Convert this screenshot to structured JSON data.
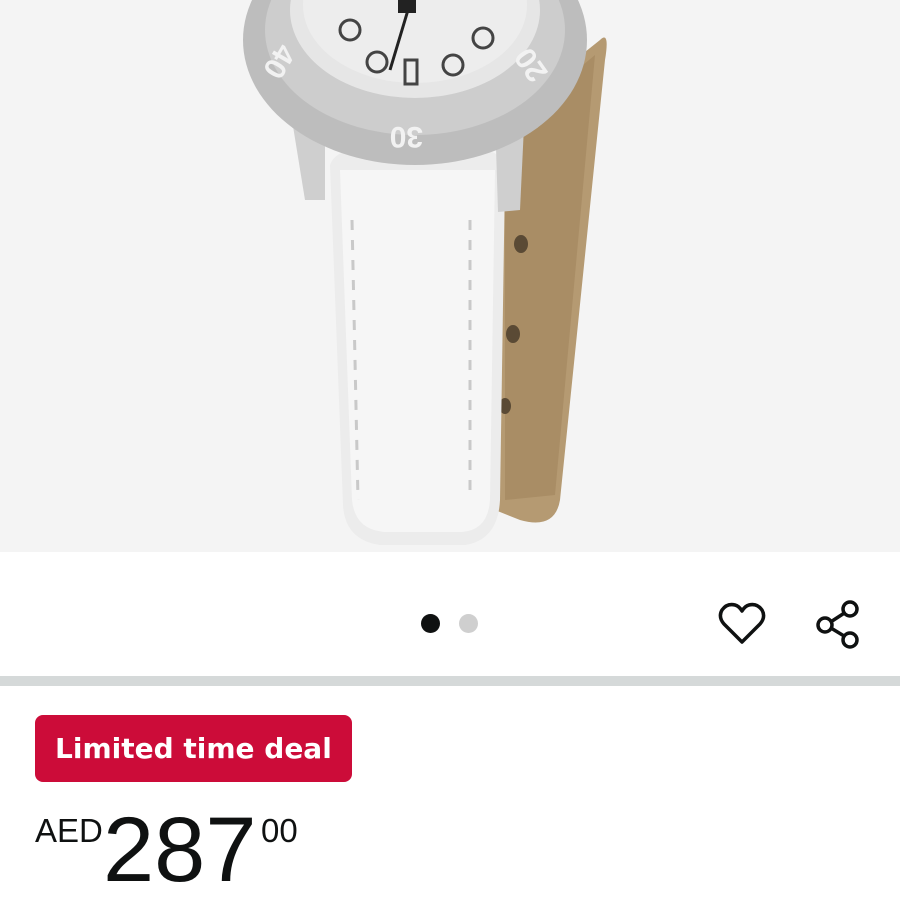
{
  "product": {
    "image_alt": "White leather strap wristwatch",
    "bezel_numbers": [
      "40",
      "30",
      "20"
    ]
  },
  "gallery": {
    "image_count": 2,
    "active_index": 0
  },
  "actions": {
    "wishlist_icon": "heart-outline-icon",
    "share_icon": "share-icon"
  },
  "deal": {
    "badge_label": "Limited time deal",
    "badge_color": "#cc0c39"
  },
  "price": {
    "currency": "AED",
    "whole": "287",
    "fraction": "00"
  },
  "colors": {
    "text": "#0f1111",
    "divider": "#d5d9d9",
    "image_background": "#f4f4f4",
    "dot_active": "#0f1111",
    "dot_inactive": "#cfcfcf"
  }
}
